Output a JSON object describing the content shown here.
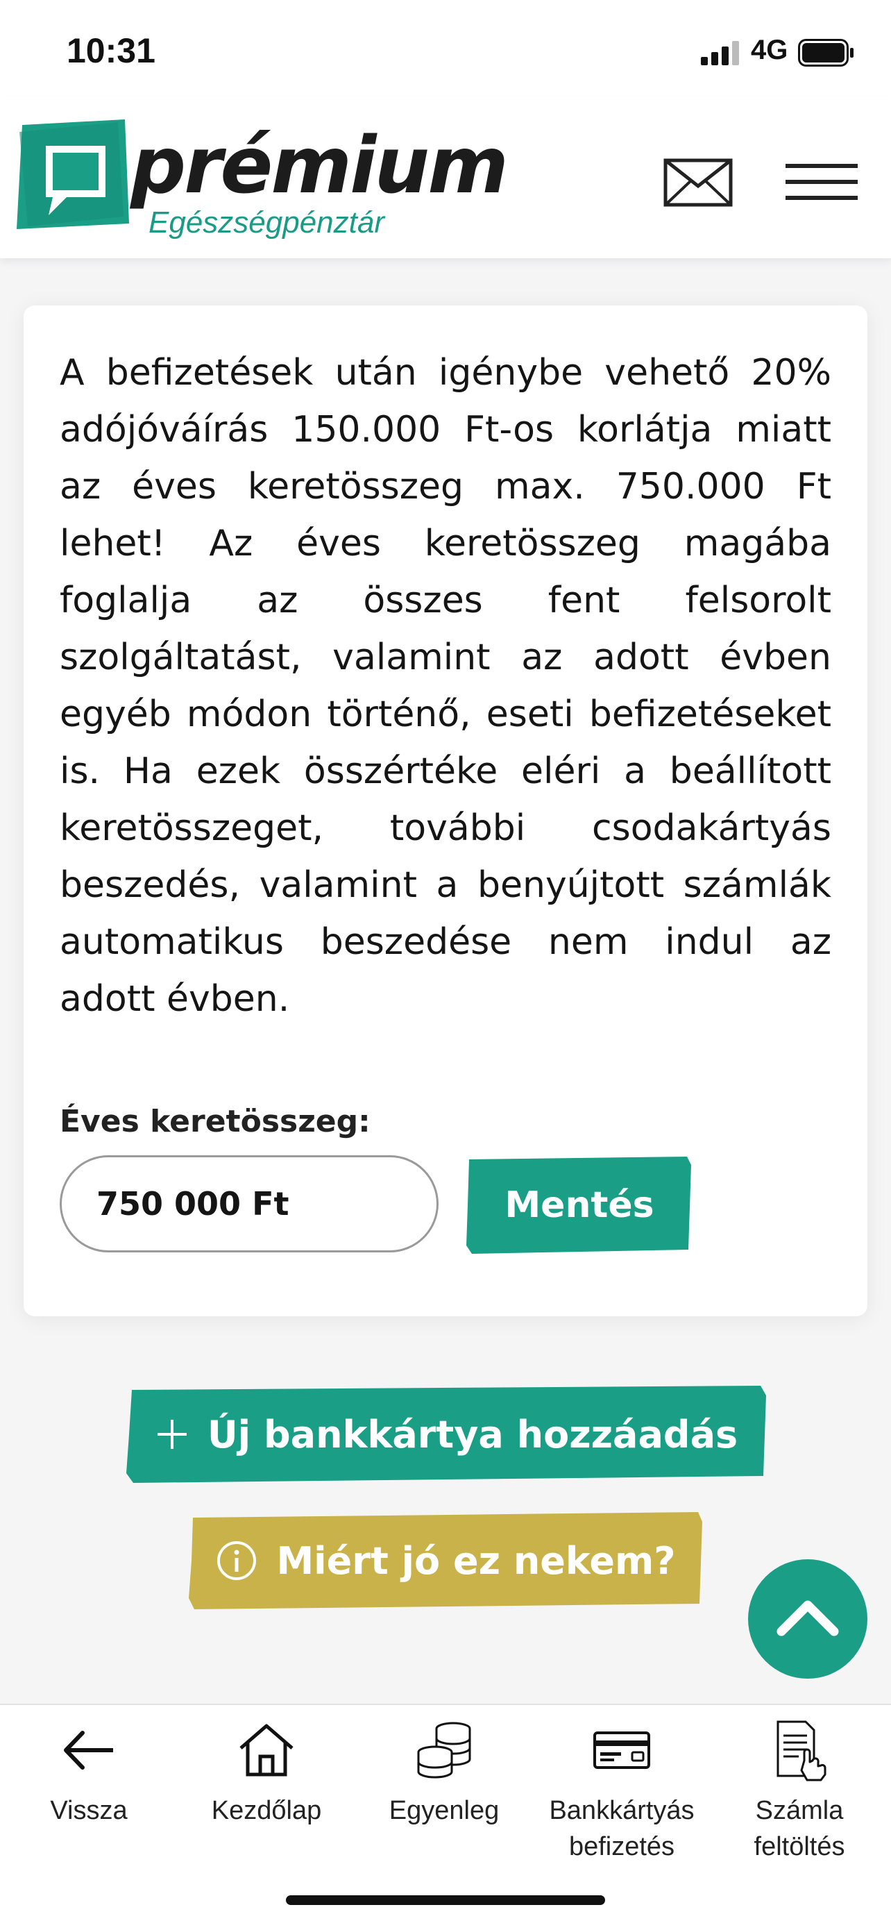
{
  "status_bar": {
    "time": "10:31",
    "network": "4G"
  },
  "header": {
    "logo_word": "prémium",
    "logo_subtitle": "Egészségpénztár"
  },
  "card": {
    "body_text": "A befizetések után igénybe vehető 20% adójóváírás 150.000 Ft-os korlátja miatt az éves keretösszeg max. 750.000 Ft lehet! Az éves keretösszeg magába foglalja az összes fent felsorolt szolgáltatást, valamint az adott évben egyéb módon történő, eseti befizetéseket is. Ha ezek összértéke eléri a beállított keretösszeget, további csodakártyás beszedés, valamint a benyújtott számlák automatikus beszedése nem indul az adott évben.",
    "field_label": "Éves keretösszeg:",
    "amount_value": "750 000 Ft",
    "save_label": "Mentés"
  },
  "actions": {
    "add_card_label": "Új bankkártya hozzáadás",
    "why_label": "Miért jó ez nekem?"
  },
  "bottom_nav": [
    {
      "label": "Vissza",
      "icon": "arrow-left-icon"
    },
    {
      "label": "Kezdőlap",
      "icon": "home-icon"
    },
    {
      "label": "Egyenleg",
      "icon": "coins-icon"
    },
    {
      "label": "Bankkártyás\nbefizetés",
      "icon": "credit-card-icon"
    },
    {
      "label": "Számla\nfeltöltés",
      "icon": "invoice-upload-icon"
    }
  ],
  "colors": {
    "brand_green": "#1a9e86",
    "brand_gold": "#c9b24a",
    "text_dark": "#151515"
  }
}
